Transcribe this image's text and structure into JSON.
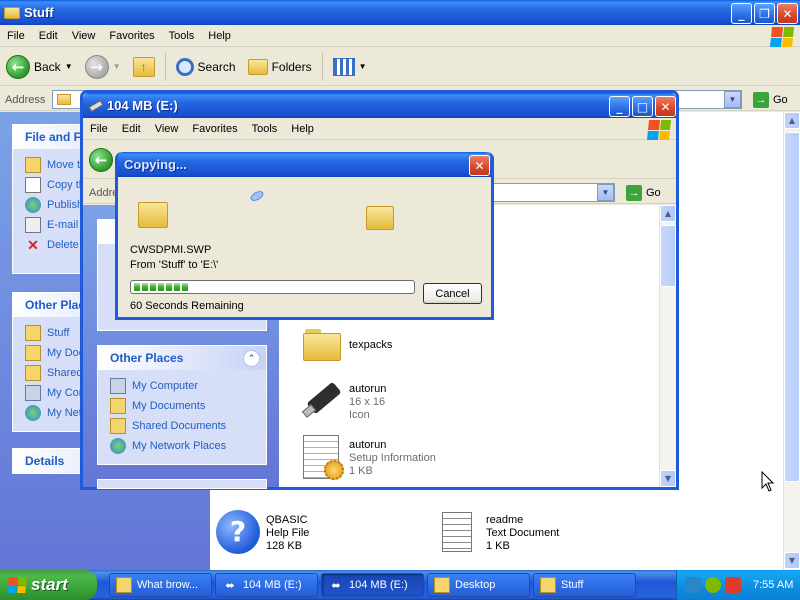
{
  "back_window": {
    "title": "Stuff",
    "menu": [
      "File",
      "Edit",
      "View",
      "Favorites",
      "Tools",
      "Help"
    ],
    "toolbar": {
      "back": "Back",
      "search": "Search",
      "folders": "Folders"
    },
    "address_label": "Address",
    "go": "Go",
    "file_tasks_title": "File and Folder Tasks",
    "file_tasks": [
      "Move this file",
      "Copy this file",
      "Publish this file to the Web",
      "E-mail this file",
      "Delete this file"
    ],
    "other_places_title": "Other Places",
    "other_places": [
      "Stuff",
      "My Documents",
      "Shared Documents",
      "My Computer",
      "My Network Places"
    ],
    "details_title": "Details",
    "files": [
      {
        "name": "QBASIC",
        "type": "Help File",
        "size": "128 KB"
      },
      {
        "name": "readme",
        "type": "Text Document",
        "size": "1 KB"
      }
    ]
  },
  "front_window": {
    "title": "104 MB (E:)",
    "menu": [
      "File",
      "Edit",
      "View",
      "Favorites",
      "Tools",
      "Help"
    ],
    "address_label": "Address",
    "go": "Go",
    "other_places_title": "Other Places",
    "other_places": [
      "My Computer",
      "My Documents",
      "Shared Documents",
      "My Network Places"
    ],
    "files": [
      {
        "name": "texpacks",
        "type": "",
        "size": ""
      },
      {
        "name": "autorun",
        "type": "16 x 16",
        "size": "Icon"
      },
      {
        "name": "autorun",
        "type": "Setup Information",
        "size": "1 KB"
      }
    ]
  },
  "copy_dialog": {
    "title": "Copying...",
    "filename": "CWSDPMI.SWP",
    "from_to": "From 'Stuff' to 'E:\\'",
    "remaining": "60 Seconds Remaining",
    "cancel": "Cancel",
    "progress_fraction": 0.2
  },
  "taskbar": {
    "start": "start",
    "tasks": [
      "What brow...",
      "104 MB (E:)",
      "104 MB (E:)",
      "Desktop",
      "Stuff"
    ],
    "clock": "7:55 AM"
  },
  "colors": {
    "xp_blue": "#2466e0",
    "task_blue": "#215dc6",
    "tray": "#0d8ce0",
    "start_green": "#35a035"
  }
}
